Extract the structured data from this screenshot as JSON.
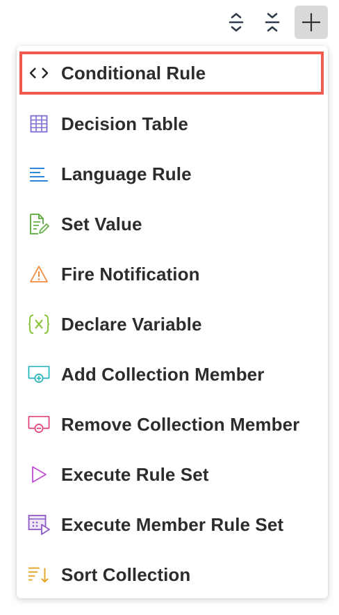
{
  "toolbar": {
    "expand_icon": "expand-vertical-icon",
    "collapse_icon": "collapse-vertical-icon",
    "add_icon": "plus-icon"
  },
  "menu": {
    "items": [
      {
        "label": "Conditional Rule",
        "icon": "code-brackets-icon",
        "color": "#222222"
      },
      {
        "label": "Decision Table",
        "icon": "grid-table-icon",
        "color": "#7b6fd6"
      },
      {
        "label": "Language Rule",
        "icon": "text-lines-icon",
        "color": "#2f86d8"
      },
      {
        "label": "Set Value",
        "icon": "document-edit-icon",
        "color": "#6ab04c"
      },
      {
        "label": "Fire Notification",
        "icon": "warning-triangle-icon",
        "color": "#ef8a3c"
      },
      {
        "label": "Declare Variable",
        "icon": "variable-icon",
        "color": "#8dc63f"
      },
      {
        "label": "Add Collection Member",
        "icon": "add-member-icon",
        "color": "#24b3b8"
      },
      {
        "label": "Remove Collection Member",
        "icon": "remove-member-icon",
        "color": "#e0407a"
      },
      {
        "label": "Execute Rule Set",
        "icon": "play-triangle-icon",
        "color": "#c04fd6"
      },
      {
        "label": "Execute Member Rule Set",
        "icon": "execute-member-icon",
        "color": "#8e5ac8"
      },
      {
        "label": "Sort Collection",
        "icon": "sort-icon",
        "color": "#e6a31e"
      }
    ],
    "highlight_color": "#f05a50"
  }
}
